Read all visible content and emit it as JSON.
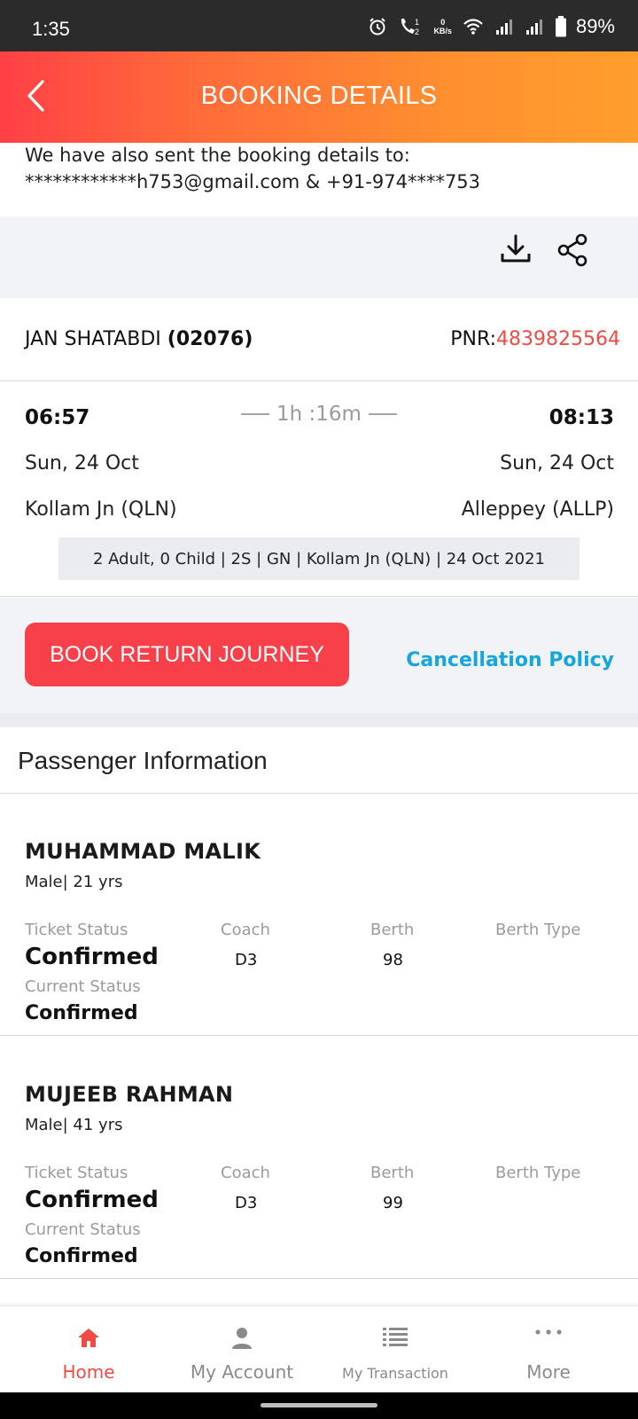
{
  "status_bar": {
    "time": "1:35",
    "network_speed_value": "0",
    "network_speed_unit": "KB/s",
    "battery": "89%"
  },
  "header": {
    "title": "BOOKING DETAILS"
  },
  "notice": {
    "line1": "We have also sent the booking details to:",
    "line2": "************h753@gmail.com & +91-974****753"
  },
  "train": {
    "name": "JAN SHATABDI",
    "number": "(02076)",
    "pnr_label": "PNR:",
    "pnr_value": "4839825564",
    "pnr_color": "#f04a43"
  },
  "journey": {
    "departure_time": "06:57",
    "arrival_time": "08:13",
    "duration": "1h :16m",
    "departure_date": "Sun, 24 Oct",
    "arrival_date": "Sun, 24 Oct",
    "departure_station": "Kollam Jn (QLN)",
    "arrival_station": "Alleppey (ALLP)",
    "summary": "2 Adult, 0 Child | 2S | GN | Kollam Jn (QLN) | 24 Oct 2021"
  },
  "actions": {
    "book_return_label": "BOOK RETURN JOURNEY",
    "cancellation_policy_label": "Cancellation Policy",
    "accent_red": "#f7404a",
    "link_blue": "#15a6e0"
  },
  "passenger_section": {
    "title": "Passenger Information",
    "labels": {
      "ticket_status": "Ticket Status",
      "coach": "Coach",
      "berth": "Berth",
      "berth_type": "Berth Type",
      "current_status": "Current Status"
    },
    "passengers": [
      {
        "name": "MUHAMMAD MALIK",
        "meta": "Male| 21 yrs",
        "ticket_status": "Confirmed",
        "coach": "D3",
        "berth": "98",
        "current_status": "Confirmed"
      },
      {
        "name": "MUJEEB RAHMAN",
        "meta": "Male| 41 yrs",
        "ticket_status": "Confirmed",
        "coach": "D3",
        "berth": "99",
        "current_status": "Confirmed"
      }
    ]
  },
  "bottom_nav": {
    "items": [
      {
        "label": "Home",
        "icon": "home-icon",
        "active": true
      },
      {
        "label": "My Account",
        "icon": "person-icon",
        "active": false
      },
      {
        "label": "My Transaction",
        "icon": "list-icon",
        "active": false
      },
      {
        "label": "More",
        "icon": "more-dots-icon",
        "active": false
      }
    ]
  }
}
